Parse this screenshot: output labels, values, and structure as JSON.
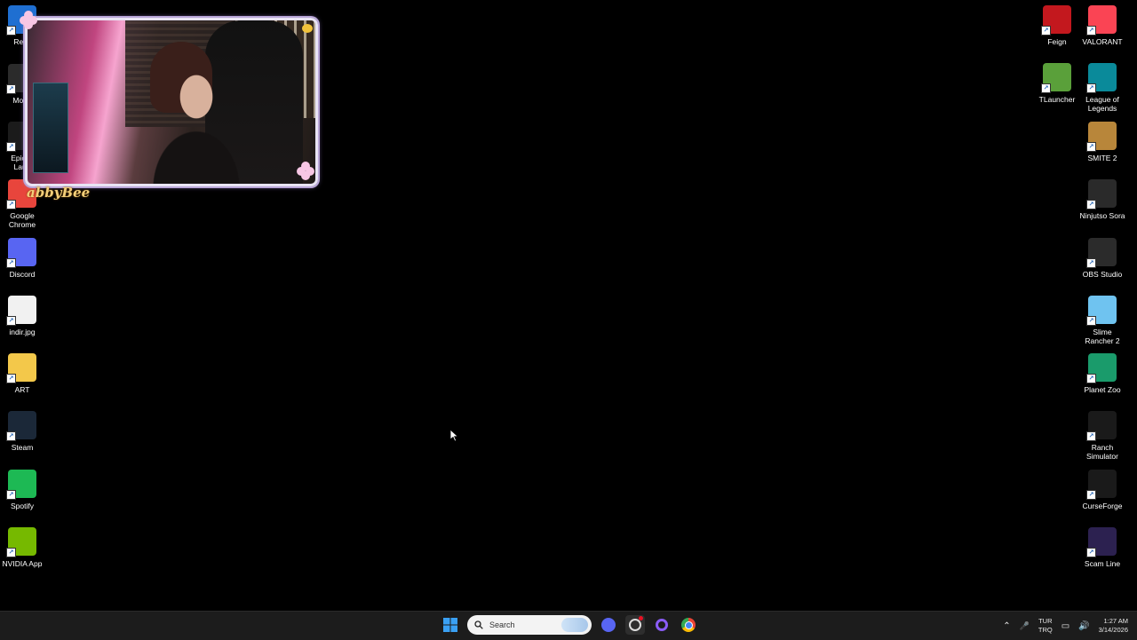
{
  "desktop": {
    "left_icons": [
      {
        "label": "Recy",
        "color": "#1f6fd1",
        "icon": "recycle-bin-icon"
      },
      {
        "label": "Moba",
        "color": "#2b2b2b",
        "icon": "moba-icon"
      },
      {
        "label": "Epic G\nLaun",
        "color": "#1b1b1b",
        "icon": "epic-games-icon"
      },
      {
        "label": "Google\nChrome",
        "color": "#e8453c",
        "icon": "chrome-icon"
      },
      {
        "label": "Discord",
        "color": "#5865f2",
        "icon": "discord-icon"
      },
      {
        "label": "indir.jpg",
        "color": "#f1f1f1",
        "icon": "image-file-icon"
      },
      {
        "label": "ART",
        "color": "#f3c84a",
        "icon": "folder-icon"
      },
      {
        "label": "Steam",
        "color": "#1b2838",
        "icon": "steam-icon"
      },
      {
        "label": "Spotify",
        "color": "#1db954",
        "icon": "spotify-icon"
      },
      {
        "label": "NVIDIA App",
        "color": "#76b900",
        "icon": "nvidia-icon"
      }
    ],
    "right_icons": [
      {
        "label": "Feign",
        "color": "#c3181e",
        "icon": "feign-icon"
      },
      {
        "label": "VALORANT",
        "color": "#fa4454",
        "icon": "valorant-icon"
      },
      {
        "label": "TLauncher",
        "color": "#5aa03a",
        "icon": "tlauncher-icon"
      },
      {
        "label": "League of\nLegends",
        "color": "#0a8a9a",
        "icon": "league-icon"
      },
      {
        "label": "SMITE 2",
        "color": "#b8863a",
        "icon": "smite-icon"
      },
      {
        "label": "Ninjutso Sora",
        "color": "#2a2a2a",
        "icon": "ninjutso-icon"
      },
      {
        "label": "OBS Studio",
        "color": "#2b2b2b",
        "icon": "obs-icon"
      },
      {
        "label": "Slime\nRancher 2",
        "color": "#6fc3f0",
        "icon": "slime-rancher-icon"
      },
      {
        "label": "Planet Zoo",
        "color": "#1a9b6b",
        "icon": "planet-zoo-icon"
      },
      {
        "label": "Ranch\nSimulator",
        "color": "#1a1a1a",
        "icon": "ranch-simulator-icon"
      },
      {
        "label": "CurseForge",
        "color": "#1a1a1a",
        "icon": "curseforge-icon"
      },
      {
        "label": "Scam Line",
        "color": "#2c2150",
        "icon": "scam-line-icon"
      }
    ]
  },
  "overlay": {
    "name": "abbyBee"
  },
  "taskbar": {
    "search_placeholder": "Search",
    "language_top": "TUR",
    "language_bottom": "TRQ",
    "time": "1:27 AM",
    "date": "3/14/2026"
  },
  "colors": {
    "taskbar_bg": "#1c1c1c",
    "windows_blue": "#0078d4"
  }
}
